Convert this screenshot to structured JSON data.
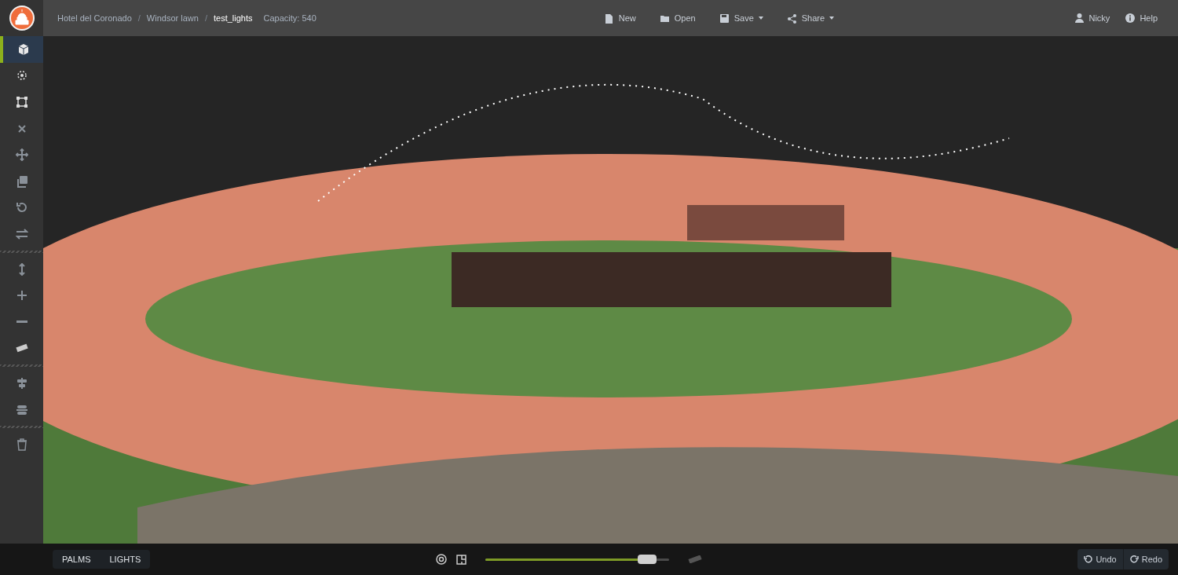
{
  "breadcrumbs": [
    {
      "label": "Hotel del Coronado"
    },
    {
      "separator": "/",
      "label": "Windsor lawn"
    },
    {
      "separator": "/",
      "label": "test_lights"
    }
  ],
  "capacity": "Capacity: 540",
  "menu": [
    {
      "label": "New",
      "kind": "file",
      "dropdown": false
    },
    {
      "label": "Open",
      "kind": "folder",
      "dropdown": false
    },
    {
      "label": "Save",
      "kind": "save",
      "dropdown": true
    },
    {
      "label": "Share",
      "kind": "share",
      "dropdown": true
    }
  ],
  "user": "Nicky",
  "help": "Help",
  "tool_groups": [
    {
      "tools": [
        {
          "kind": "cube",
          "selected": true
        },
        {
          "kind": "sparkle",
          "selected": false
        },
        {
          "kind": "select",
          "selected": false
        },
        {
          "kind": "close",
          "selected": false
        },
        {
          "kind": "move",
          "selected": false
        },
        {
          "kind": "copy",
          "selected": false
        },
        {
          "kind": "rotate",
          "selected": false
        },
        {
          "kind": "swap",
          "selected": false
        }
      ]
    },
    {
      "tools": [
        {
          "kind": "height",
          "selected": false
        },
        {
          "kind": "plus",
          "selected": false
        },
        {
          "kind": "minus",
          "selected": false
        },
        {
          "kind": "ruler",
          "selected": false
        }
      ]
    },
    {
      "tools": [
        {
          "kind": "align-center",
          "selected": false
        },
        {
          "kind": "align-middle",
          "selected": false
        }
      ]
    },
    {
      "tools": [
        {
          "kind": "trash",
          "selected": false
        }
      ]
    }
  ],
  "layers": [
    {
      "label": "PALMS"
    },
    {
      "label": "LIGHTS"
    }
  ],
  "zoom_slider": {
    "level": 0.88
  },
  "undo": "Undo",
  "redo": "Redo"
}
